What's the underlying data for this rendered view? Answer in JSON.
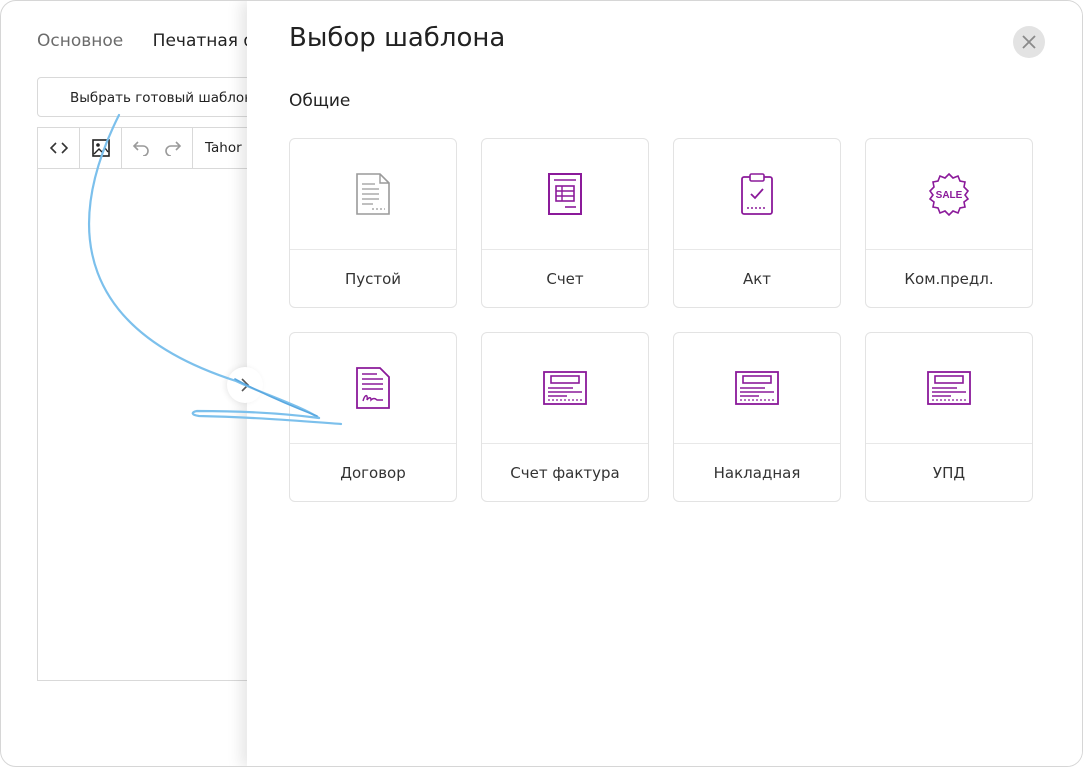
{
  "background": {
    "tabs": [
      {
        "label": "Основное"
      },
      {
        "label": "Печатная фо"
      }
    ],
    "choose_template_button": "Выбрать готовый шаблон",
    "toolbar": {
      "font_name": "Tahor"
    }
  },
  "modal": {
    "title": "Выбор шаблона",
    "section_title": "Общие",
    "templates": [
      {
        "label": "Пустой",
        "icon": "blank-document-icon"
      },
      {
        "label": "Счет",
        "icon": "invoice-icon"
      },
      {
        "label": "Акт",
        "icon": "act-clipboard-icon"
      },
      {
        "label": "Ком.предл.",
        "icon": "sale-badge-icon"
      },
      {
        "label": "Договор",
        "icon": "contract-signature-icon"
      },
      {
        "label": "Счет фактура",
        "icon": "invoice-form-icon"
      },
      {
        "label": "Накладная",
        "icon": "waybill-form-icon"
      },
      {
        "label": "УПД",
        "icon": "upd-form-icon"
      }
    ],
    "sale_badge_text": "SALE"
  },
  "colors": {
    "accent": "#8b1a9a",
    "muted_icon": "#9a9a9a",
    "annotation_arrow": "#7cc0ec"
  }
}
